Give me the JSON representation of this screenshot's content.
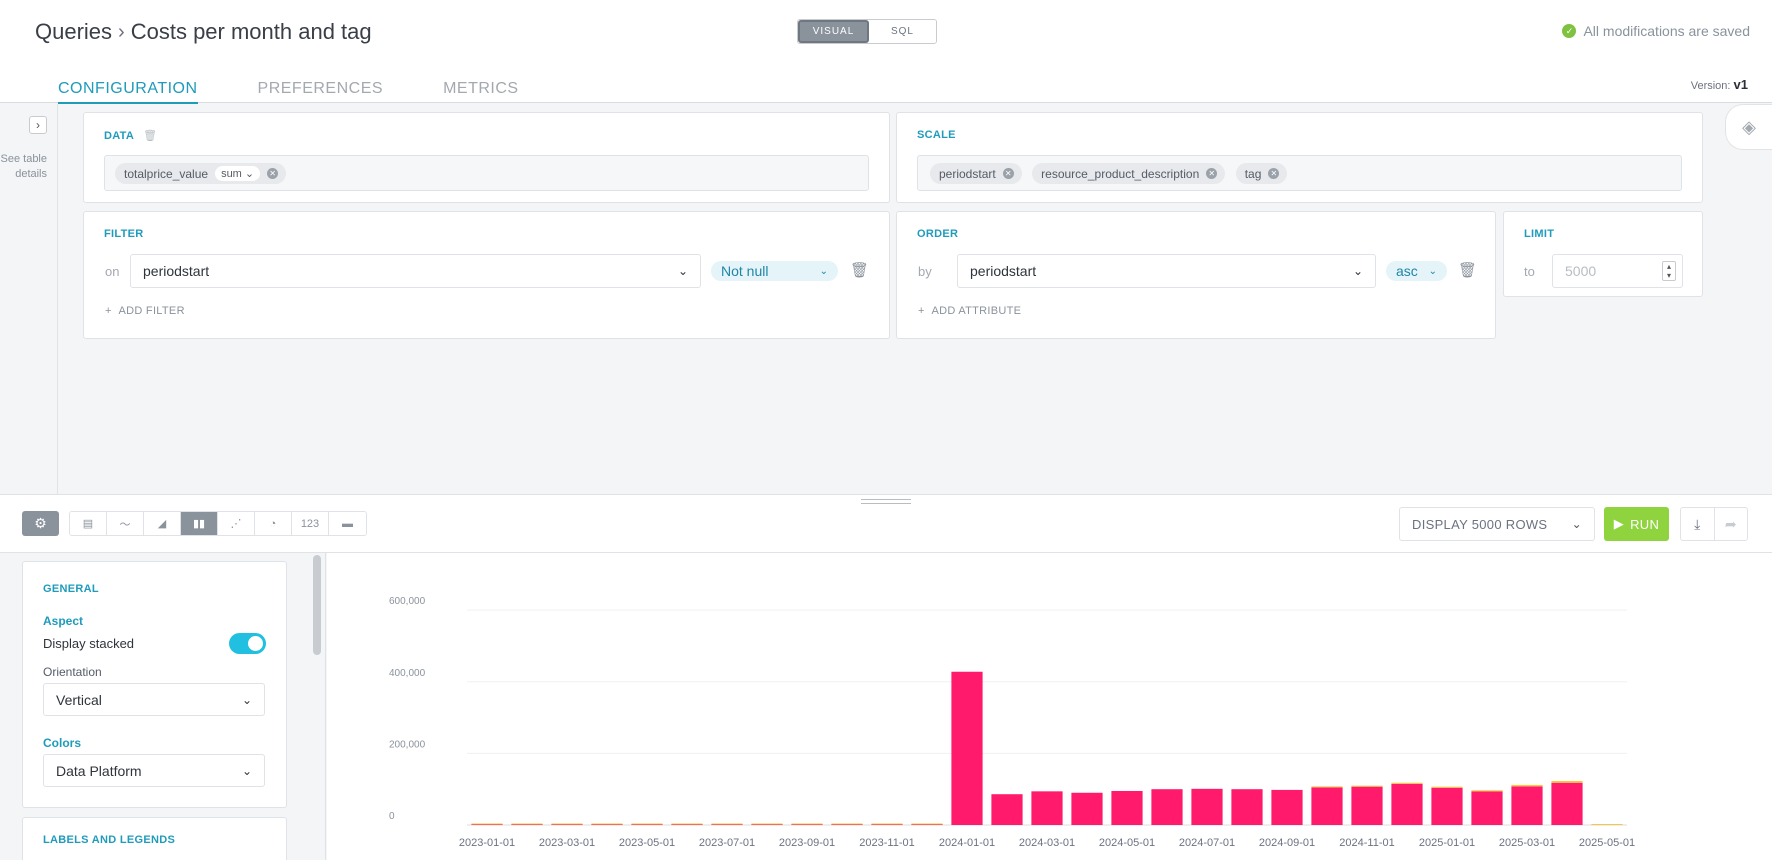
{
  "header": {
    "breadcrumb_root": "Queries",
    "breadcrumb_current": "Costs per month  and tag",
    "mode_visual": "VISUAL",
    "mode_sql": "SQL",
    "saved_status": "All modifications are saved",
    "version_label": "Version:",
    "version_value": "v1"
  },
  "tabs": [
    "CONFIGURATION",
    "PREFERENCES",
    "METRICS"
  ],
  "side": {
    "see_table": "See table details"
  },
  "data_panel": {
    "title": "DATA",
    "chip_label": "totalprice_value",
    "chip_agg": "sum"
  },
  "scale_panel": {
    "title": "SCALE",
    "chips": [
      "periodstart",
      "resource_product_description",
      "tag"
    ]
  },
  "filter_panel": {
    "title": "FILTER",
    "on_label": "on",
    "field": "periodstart",
    "condition": "Not null",
    "add_label": "ADD FILTER"
  },
  "order_panel": {
    "title": "ORDER",
    "by_label": "by",
    "field": "periodstart",
    "direction": "asc",
    "add_label": "ADD ATTRIBUTE"
  },
  "limit_panel": {
    "title": "LIMIT",
    "to_label": "to",
    "placeholder": "5000"
  },
  "toolbar": {
    "rows_label": "DISPLAY 5000 ROWS",
    "run_label": "RUN",
    "viz_icons": [
      "table-icon",
      "line-chart-icon",
      "area-chart-icon",
      "bar-chart-icon",
      "scatter-icon",
      "pie-chart-icon",
      "number-icon",
      "gauge-icon"
    ],
    "active_viz": "bar-chart-icon"
  },
  "settings": {
    "general_title": "GENERAL",
    "aspect_title": "Aspect",
    "display_stacked": "Display stacked",
    "stacked_on": true,
    "orientation_label": "Orientation",
    "orientation_value": "Vertical",
    "colors_title": "Colors",
    "colors_value": "Data Platform",
    "labels_title": "LABELS AND LEGENDS"
  },
  "colors": {
    "accent": "#1f9bbb",
    "bar_main": "#ff1a6b",
    "bar_small": "#f5c842",
    "run": "#8fd43e"
  },
  "chart_data": {
    "type": "bar",
    "stacked": true,
    "categories": [
      "2023-01-01",
      "2023-02-01",
      "2023-03-01",
      "2023-04-01",
      "2023-05-01",
      "2023-06-01",
      "2023-07-01",
      "2023-08-01",
      "2023-09-01",
      "2023-10-01",
      "2023-11-01",
      "2023-12-01",
      "2024-01-01",
      "2024-02-01",
      "2024-03-01",
      "2024-04-01",
      "2024-05-01",
      "2024-06-01",
      "2024-07-01",
      "2024-08-01",
      "2024-09-01",
      "2024-10-01",
      "2024-11-01",
      "2024-12-01",
      "2025-01-01",
      "2025-02-01",
      "2025-03-01",
      "2025-04-01",
      "2025-05-01"
    ],
    "tick_labels": [
      "2023-01-01",
      "2023-03-01",
      "2023-05-01",
      "2023-07-01",
      "2023-09-01",
      "2023-11-01",
      "2024-01-01",
      "2024-03-01",
      "2024-05-01",
      "2024-07-01",
      "2024-09-01",
      "2024-11-01",
      "2025-01-01",
      "2025-03-01",
      "2025-05-01"
    ],
    "series": [
      {
        "color": "#ff1a6b",
        "values": [
          1500,
          1500,
          1500,
          1500,
          1500,
          1500,
          1500,
          1500,
          1500,
          1500,
          1500,
          1500,
          428000,
          86000,
          94000,
          90000,
          95000,
          100000,
          101000,
          100000,
          98000,
          105000,
          107000,
          115000,
          104000,
          94000,
          108000,
          118000,
          0
        ]
      },
      {
        "color": "#f5c842",
        "values": [
          800,
          800,
          800,
          800,
          800,
          800,
          800,
          800,
          800,
          800,
          800,
          800,
          0,
          0,
          0,
          0,
          0,
          0,
          0,
          0,
          0,
          2000,
          2000,
          3000,
          3000,
          3000,
          4000,
          5000,
          2500
        ]
      }
    ],
    "yticks": [
      0,
      200000,
      400000,
      600000
    ],
    "ytick_labels": [
      "0",
      "200,000",
      "400,000",
      "600,000"
    ],
    "ylim": [
      0,
      620000
    ],
    "grid": true
  }
}
